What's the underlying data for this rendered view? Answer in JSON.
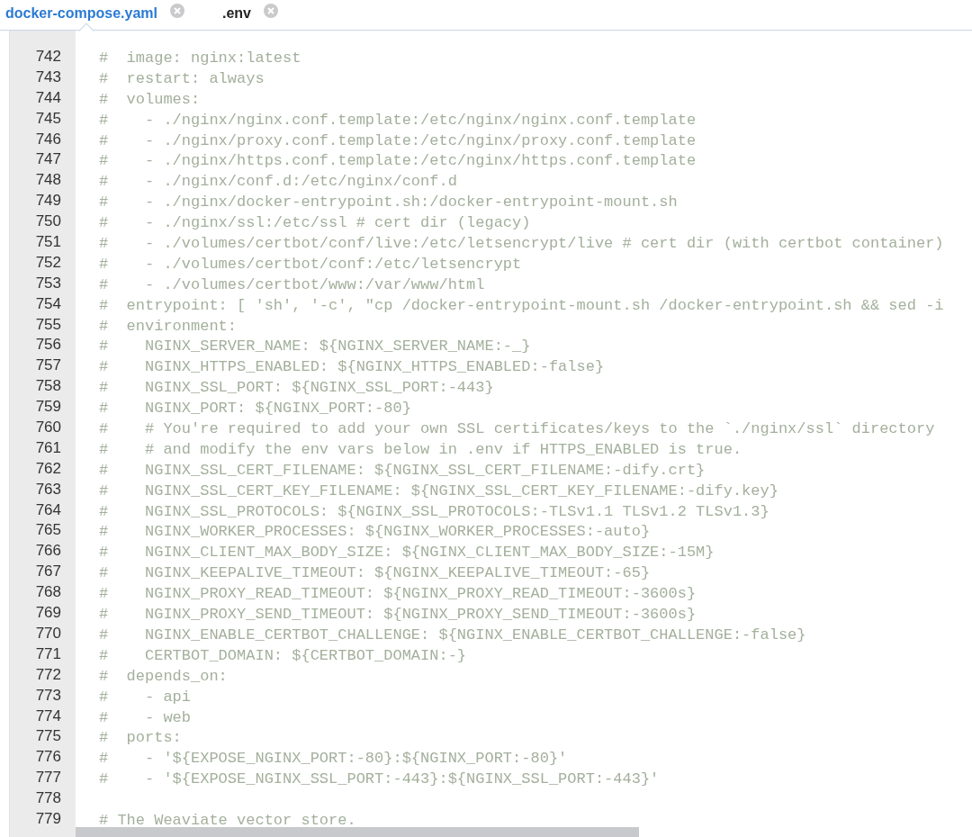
{
  "tabs": [
    {
      "label": "docker-compose.yaml",
      "selected": true
    },
    {
      "label": ".env",
      "selected": false
    }
  ],
  "lines": [
    {
      "number": "742",
      "text": "#  image: nginx:latest"
    },
    {
      "number": "743",
      "text": "#  restart: always"
    },
    {
      "number": "744",
      "text": "#  volumes:"
    },
    {
      "number": "745",
      "text": "#    - ./nginx/nginx.conf.template:/etc/nginx/nginx.conf.template"
    },
    {
      "number": "746",
      "text": "#    - ./nginx/proxy.conf.template:/etc/nginx/proxy.conf.template"
    },
    {
      "number": "747",
      "text": "#    - ./nginx/https.conf.template:/etc/nginx/https.conf.template"
    },
    {
      "number": "748",
      "text": "#    - ./nginx/conf.d:/etc/nginx/conf.d"
    },
    {
      "number": "749",
      "text": "#    - ./nginx/docker-entrypoint.sh:/docker-entrypoint-mount.sh"
    },
    {
      "number": "750",
      "text": "#    - ./nginx/ssl:/etc/ssl # cert dir (legacy)"
    },
    {
      "number": "751",
      "text": "#    - ./volumes/certbot/conf/live:/etc/letsencrypt/live # cert dir (with certbot container)"
    },
    {
      "number": "752",
      "text": "#    - ./volumes/certbot/conf:/etc/letsencrypt"
    },
    {
      "number": "753",
      "text": "#    - ./volumes/certbot/www:/var/www/html"
    },
    {
      "number": "754",
      "text": "#  entrypoint: [ 'sh', '-c', \"cp /docker-entrypoint-mount.sh /docker-entrypoint.sh && sed -i"
    },
    {
      "number": "755",
      "text": "#  environment:"
    },
    {
      "number": "756",
      "text": "#    NGINX_SERVER_NAME: ${NGINX_SERVER_NAME:-_}"
    },
    {
      "number": "757",
      "text": "#    NGINX_HTTPS_ENABLED: ${NGINX_HTTPS_ENABLED:-false}"
    },
    {
      "number": "758",
      "text": "#    NGINX_SSL_PORT: ${NGINX_SSL_PORT:-443}"
    },
    {
      "number": "759",
      "text": "#    NGINX_PORT: ${NGINX_PORT:-80}"
    },
    {
      "number": "760",
      "text": "#    # You're required to add your own SSL certificates/keys to the `./nginx/ssl` directory"
    },
    {
      "number": "761",
      "text": "#    # and modify the env vars below in .env if HTTPS_ENABLED is true."
    },
    {
      "number": "762",
      "text": "#    NGINX_SSL_CERT_FILENAME: ${NGINX_SSL_CERT_FILENAME:-dify.crt}"
    },
    {
      "number": "763",
      "text": "#    NGINX_SSL_CERT_KEY_FILENAME: ${NGINX_SSL_CERT_KEY_FILENAME:-dify.key}"
    },
    {
      "number": "764",
      "text": "#    NGINX_SSL_PROTOCOLS: ${NGINX_SSL_PROTOCOLS:-TLSv1.1 TLSv1.2 TLSv1.3}"
    },
    {
      "number": "765",
      "text": "#    NGINX_WORKER_PROCESSES: ${NGINX_WORKER_PROCESSES:-auto}"
    },
    {
      "number": "766",
      "text": "#    NGINX_CLIENT_MAX_BODY_SIZE: ${NGINX_CLIENT_MAX_BODY_SIZE:-15M}"
    },
    {
      "number": "767",
      "text": "#    NGINX_KEEPALIVE_TIMEOUT: ${NGINX_KEEPALIVE_TIMEOUT:-65}"
    },
    {
      "number": "768",
      "text": "#    NGINX_PROXY_READ_TIMEOUT: ${NGINX_PROXY_READ_TIMEOUT:-3600s}"
    },
    {
      "number": "769",
      "text": "#    NGINX_PROXY_SEND_TIMEOUT: ${NGINX_PROXY_SEND_TIMEOUT:-3600s}"
    },
    {
      "number": "770",
      "text": "#    NGINX_ENABLE_CERTBOT_CHALLENGE: ${NGINX_ENABLE_CERTBOT_CHALLENGE:-false}"
    },
    {
      "number": "771",
      "text": "#    CERTBOT_DOMAIN: ${CERTBOT_DOMAIN:-}"
    },
    {
      "number": "772",
      "text": "#  depends_on:"
    },
    {
      "number": "773",
      "text": "#    - api"
    },
    {
      "number": "774",
      "text": "#    - web"
    },
    {
      "number": "775",
      "text": "#  ports:"
    },
    {
      "number": "776",
      "text": "#    - '${EXPOSE_NGINX_PORT:-80}:${NGINX_PORT:-80}'"
    },
    {
      "number": "777",
      "text": "#    - '${EXPOSE_NGINX_SSL_PORT:-443}:${NGINX_SSL_PORT:-443}'"
    },
    {
      "number": "778"
    },
    {
      "number": "779",
      "text": "# The Weaviate vector store."
    }
  ]
}
